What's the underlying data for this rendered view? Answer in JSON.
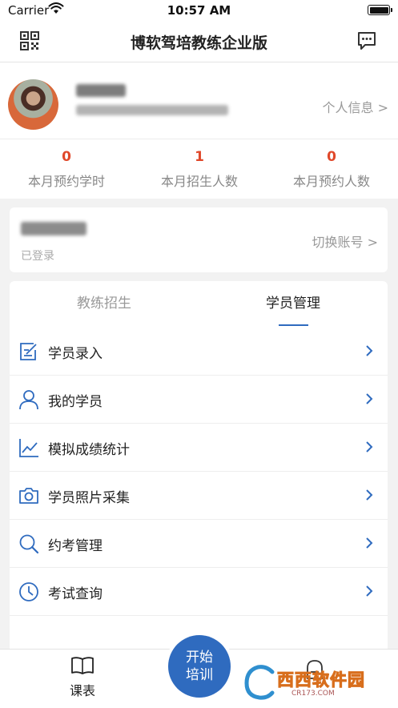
{
  "status_bar": {
    "carrier": "Carrier",
    "time": "10:57 AM"
  },
  "nav": {
    "title": "博软驾培教练企业版"
  },
  "profile": {
    "link": "个人信息 >"
  },
  "stats": [
    {
      "value": "0",
      "label": "本月预约学时"
    },
    {
      "value": "1",
      "label": "本月招生人数"
    },
    {
      "value": "0",
      "label": "本月预约人数"
    }
  ],
  "account": {
    "status": "已登录",
    "switch_label": "切换账号 >"
  },
  "tabs": {
    "recruit": "教练招生",
    "manage": "学员管理"
  },
  "menu": [
    {
      "label": "学员录入",
      "icon": "edit-icon"
    },
    {
      "label": "我的学员",
      "icon": "user-icon"
    },
    {
      "label": "模拟成绩统计",
      "icon": "chart-icon"
    },
    {
      "label": "学员照片采集",
      "icon": "camera-icon"
    },
    {
      "label": "约考管理",
      "icon": "search-icon"
    },
    {
      "label": "考试查询",
      "icon": "clock-icon"
    }
  ],
  "tabbar": {
    "schedule": "课表",
    "start_training_line1": "开始",
    "start_training_line2": "培训"
  },
  "watermark": {
    "brand": "西西软件园",
    "url": "CR173.COM"
  },
  "colors": {
    "accent": "#2f6bbf",
    "stat": "#e0482a"
  }
}
